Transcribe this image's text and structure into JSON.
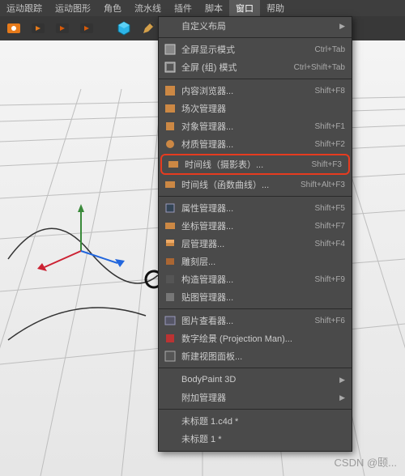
{
  "menubar": [
    "运动跟踪",
    "运动图形",
    "角色",
    "流水线",
    "插件",
    "脚本",
    "窗口",
    "帮助"
  ],
  "dropdown": {
    "custom_layout": "自定义布局",
    "fullscreen": {
      "label": "全屏显示模式",
      "shortcut": "Ctrl+Tab"
    },
    "fullscreen_group": {
      "label": "全屏 (组) 模式",
      "shortcut": "Ctrl+Shift+Tab"
    },
    "content_browser": {
      "label": "内容浏览器...",
      "shortcut": "Shift+F8"
    },
    "take_manager": {
      "label": "场次管理器"
    },
    "object_manager": {
      "label": "对象管理器...",
      "shortcut": "Shift+F1"
    },
    "material_manager": {
      "label": "材质管理器...",
      "shortcut": "Shift+F2"
    },
    "timeline_dope": {
      "label": "时间线（摄影表）...",
      "shortcut": "Shift+F3"
    },
    "timeline_fcurve": {
      "label": "时间线（函数曲线）...",
      "shortcut": "Shift+Alt+F3"
    },
    "attribute_manager": {
      "label": "属性管理器...",
      "shortcut": "Shift+F5"
    },
    "coordinate_manager": {
      "label": "坐标管理器...",
      "shortcut": "Shift+F7"
    },
    "layer_manager": {
      "label": "层管理器...",
      "shortcut": "Shift+F4"
    },
    "sculpt_layers": {
      "label": "雕刻层..."
    },
    "structure_manager": {
      "label": "构造管理器...",
      "shortcut": "Shift+F9"
    },
    "texture_manager": {
      "label": "贴图管理器..."
    },
    "picture_viewer": {
      "label": "图片查看器...",
      "shortcut": "Shift+F6"
    },
    "projection_man": {
      "label": "数字绘景 (Projection Man)..."
    },
    "new_view_panel": {
      "label": "新建视图面板..."
    },
    "bodypaint": {
      "label": "BodyPaint 3D"
    },
    "additional_managers": {
      "label": "附加管理器"
    },
    "doc1": {
      "label": "未标题 1.c4d *"
    },
    "doc2": {
      "label": "未标题 1 *"
    }
  },
  "watermark": "CSDN @颐..."
}
